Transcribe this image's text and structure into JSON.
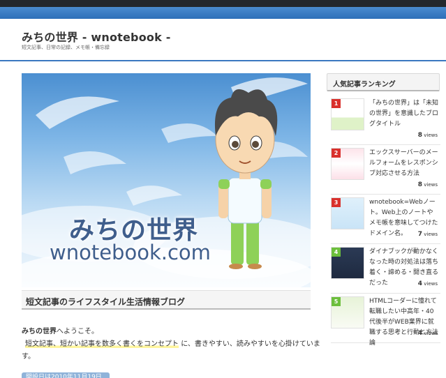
{
  "header": {
    "site_title": "みちの世界 - wnotebook -",
    "site_description": "短文記事、日常の記録、メモ帳・備忘録"
  },
  "hero": {
    "text_main": "みちの世界",
    "text_sub": "wnotebook.com"
  },
  "main": {
    "section_title": "短文記事のライフスタイル生活情報ブログ",
    "welcome_bold": "みちの世界",
    "welcome_rest": "へようこそ。",
    "concept_highlight": "短文記事、短かい記事を数多く書くをコンセプト",
    "concept_rest": "に、書きやすい、読みやすいを心掛けていま",
    "concept_end": "す。",
    "date_badge": "開設日は2010年11月19日"
  },
  "sidebar": {
    "ranking_title": "人気記事ランキング",
    "views_suffix": "views",
    "items": [
      {
        "rank": "1",
        "title": "「みちの世界」は「未知の世界」を意識したブログタイトル",
        "views": "8",
        "badge_color": "#d9302c"
      },
      {
        "rank": "2",
        "title": "エックスサーバーのメールフォームをレスポンシブ対応させる方法",
        "views": "8",
        "badge_color": "#d9302c"
      },
      {
        "rank": "3",
        "title": "wnotebook=Webノート。Web上のノートやメモ帳を意味してつけたドメイン名。",
        "views": "7",
        "badge_color": "#d9302c"
      },
      {
        "rank": "4",
        "title": "ダイナブックが動かなくなった時の対処法は落ち着く・諦める・開き直るだった",
        "views": "4",
        "badge_color": "#6cbf3c"
      },
      {
        "rank": "5",
        "title": "HTMLコーダーに憧れて転職したい中高年・40代後半がWEB業界に就職する思考と行動と方法論",
        "views": "4",
        "badge_color": "#6cbf3c"
      }
    ]
  },
  "colors": {
    "header_bar": "#2d6fb8",
    "topbar": "#23272d",
    "rank_red": "#d9302c",
    "rank_green": "#6cbf3c",
    "highlight": "#fff59d"
  }
}
